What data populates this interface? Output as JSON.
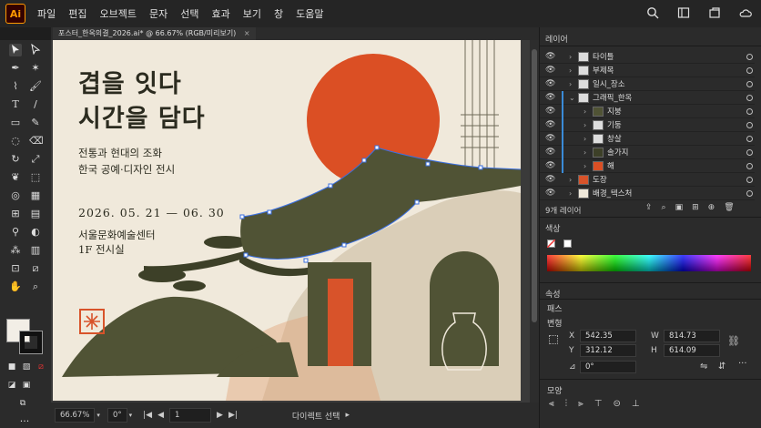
{
  "app": {
    "logo": "Ai"
  },
  "menu": [
    "파일",
    "편집",
    "오브젝트",
    "문자",
    "선택",
    "효과",
    "보기",
    "창",
    "도움말"
  ],
  "document": {
    "tab_label": "포스터_한옥의결_2026.ai* @ 66.67% (RGB/미리보기)",
    "close": "×"
  },
  "poster": {
    "title_line1": "겹을 잇다",
    "title_line2": "시간을 담다",
    "subtitle_line1": "전통과 현대의 조화",
    "subtitle_line2": "한국 공예·디자인 전시",
    "dates": "2026. 05. 21 — 06. 30",
    "venue_line1": "서울문화예술센터",
    "venue_line2": "1F 전시실"
  },
  "status": {
    "zoom": "66.67%",
    "rotation": "0°",
    "artboard": "1",
    "tool": "다이렉트 선택"
  },
  "layers": {
    "title": "레이어",
    "items": [
      {
        "label": "타이틀",
        "indent": 0
      },
      {
        "label": "부제목",
        "indent": 0
      },
      {
        "label": "일시_장소",
        "indent": 0
      },
      {
        "label": "그래픽_한옥",
        "indent": 0
      },
      {
        "label": "지붕",
        "indent": 1
      },
      {
        "label": "기둥",
        "indent": 1
      },
      {
        "label": "창살",
        "indent": 1
      },
      {
        "label": "솔가지",
        "indent": 1
      },
      {
        "label": "해",
        "indent": 1
      },
      {
        "label": "도장",
        "indent": 0
      },
      {
        "label": "배경_텍스처",
        "indent": 0
      }
    ],
    "count": "9개 레이어"
  },
  "color_panel": {
    "title": "색상"
  },
  "properties": {
    "title": "속성",
    "section_path": "패스",
    "section_transform": "변형",
    "x_label": "X",
    "x_value": "542.35",
    "y_label": "Y",
    "y_value": "312.12",
    "w_label": "W",
    "w_value": "814.73",
    "h_label": "H",
    "h_value": "614.09",
    "rotation_value": "0°",
    "section_appearance": "모양",
    "section_align": "정렬"
  },
  "colors": {
    "sun": "#db4f24",
    "ink": "#2b2b1f",
    "olive": "#505335",
    "paper": "#f0e9db",
    "selection": "#3a6fe0"
  }
}
